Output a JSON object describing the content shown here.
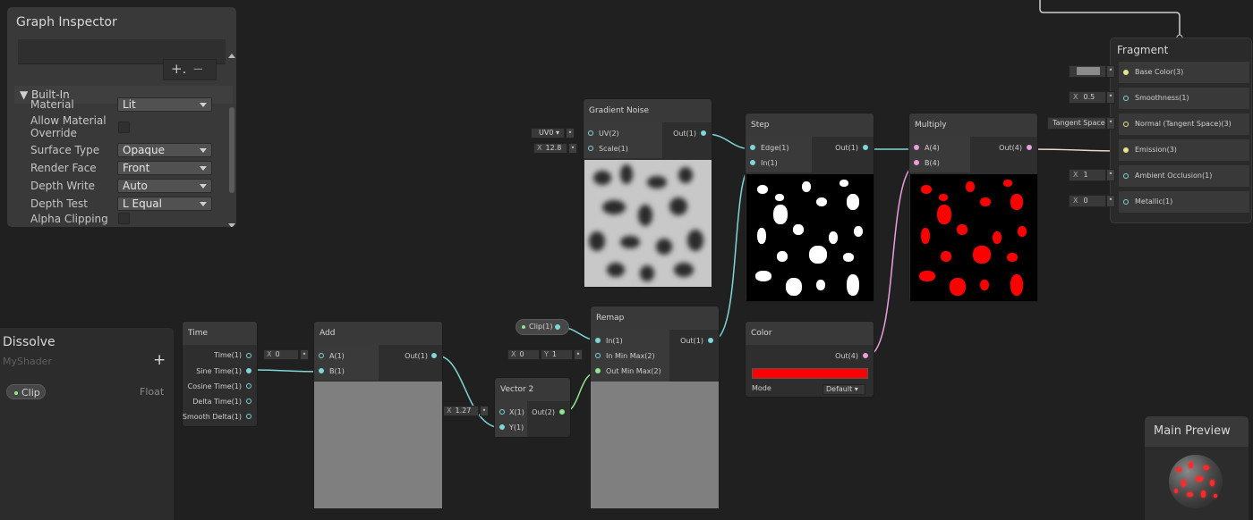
{
  "inspector": {
    "title": "Graph Inspector",
    "plus": "+.",
    "minus": "−",
    "section": "Built-In",
    "props": [
      {
        "label": "Material",
        "value": "Lit"
      },
      {
        "label": "Allow Material Override",
        "value": ""
      },
      {
        "label": "Surface Type",
        "value": "Opaque"
      },
      {
        "label": "Render Face",
        "value": "Front"
      },
      {
        "label": "Depth Write",
        "value": "Auto"
      },
      {
        "label": "Depth Test",
        "value": "L Equal"
      },
      {
        "label": "Alpha Clipping",
        "value": ""
      }
    ]
  },
  "blackboard": {
    "title": "Dissolve",
    "subtitle": "MyShader",
    "add": "+",
    "property": {
      "name": "Clip",
      "type": "Float"
    }
  },
  "nodes": {
    "time": {
      "title": "Time",
      "outputs": [
        "Time(1)",
        "Sine Time(1)",
        "Cosine Time(1)",
        "Delta Time(1)",
        "Smooth Delta(1)"
      ]
    },
    "add": {
      "title": "Add",
      "inputs": [
        "A(1)",
        "B(1)"
      ],
      "output": "Out(1)",
      "a_x": "0",
      "x_label": "X"
    },
    "vector2": {
      "title": "Vector 2",
      "inputs": [
        "X(1)",
        "Y(1)"
      ],
      "output": "Out(2)",
      "x_value": "1.27",
      "x_label": "X"
    },
    "clip_ref": {
      "label": "Clip(1)"
    },
    "remap": {
      "title": "Remap",
      "inputs": [
        "In(1)",
        "In Min Max(2)",
        "Out Min Max(2)"
      ],
      "output": "Out(1)",
      "in_x": "0",
      "in_y": "1",
      "x_label": "X",
      "y_label": "Y"
    },
    "gradient_noise": {
      "title": "Gradient Noise",
      "inputs": [
        "UV(2)",
        "Scale(1)"
      ],
      "output": "Out(1)",
      "uv": "UV0",
      "scale": "12.8",
      "x_label": "X"
    },
    "step": {
      "title": "Step",
      "inputs": [
        "Edge(1)",
        "In(1)"
      ],
      "output": "Out(1)"
    },
    "multiply": {
      "title": "Multiply",
      "inputs": [
        "A(4)",
        "B(4)"
      ],
      "output": "Out(4)"
    },
    "color": {
      "title": "Color",
      "output": "Out(4)",
      "mode_label": "Mode",
      "mode_value": "Default",
      "color": "#ff0000"
    }
  },
  "fragment": {
    "title": "Fragment",
    "rows": [
      {
        "label": "Base Color(3)",
        "field": ""
      },
      {
        "label": "Smoothness(1)",
        "field_x": "X",
        "field": "0.5"
      },
      {
        "label": "Normal (Tangent Space)(3)",
        "field": "Tangent Space"
      },
      {
        "label": "Emission(3)",
        "field": ""
      },
      {
        "label": "Ambient Occlusion(1)",
        "field_x": "X",
        "field": "1"
      },
      {
        "label": "Metallic(1)",
        "field_x": "X",
        "field": "0"
      }
    ]
  },
  "main_preview": {
    "title": "Main Preview"
  },
  "colors": {
    "vector1_wire": "#7fd6d6",
    "vector2_wire": "#8fe68f",
    "vector4_wire": "#ea9ee0",
    "vector3_wire": "#e7e28a",
    "accent_red": "#ff0000"
  }
}
